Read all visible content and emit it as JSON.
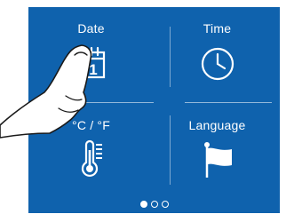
{
  "colors": {
    "panel_bg": "#0f62ad",
    "foreground": "#ffffff"
  },
  "tiles": [
    {
      "label": "Date",
      "icon": "calendar-icon",
      "icon_text": "1"
    },
    {
      "label": "Time",
      "icon": "clock-icon"
    },
    {
      "label": "°C / °F",
      "icon": "thermometer-icon"
    },
    {
      "label": "Language",
      "icon": "flag-icon"
    }
  ],
  "pagination": {
    "current_page": 1,
    "total_pages": 3
  },
  "overlay": {
    "icon": "pointing-hand-icon"
  }
}
